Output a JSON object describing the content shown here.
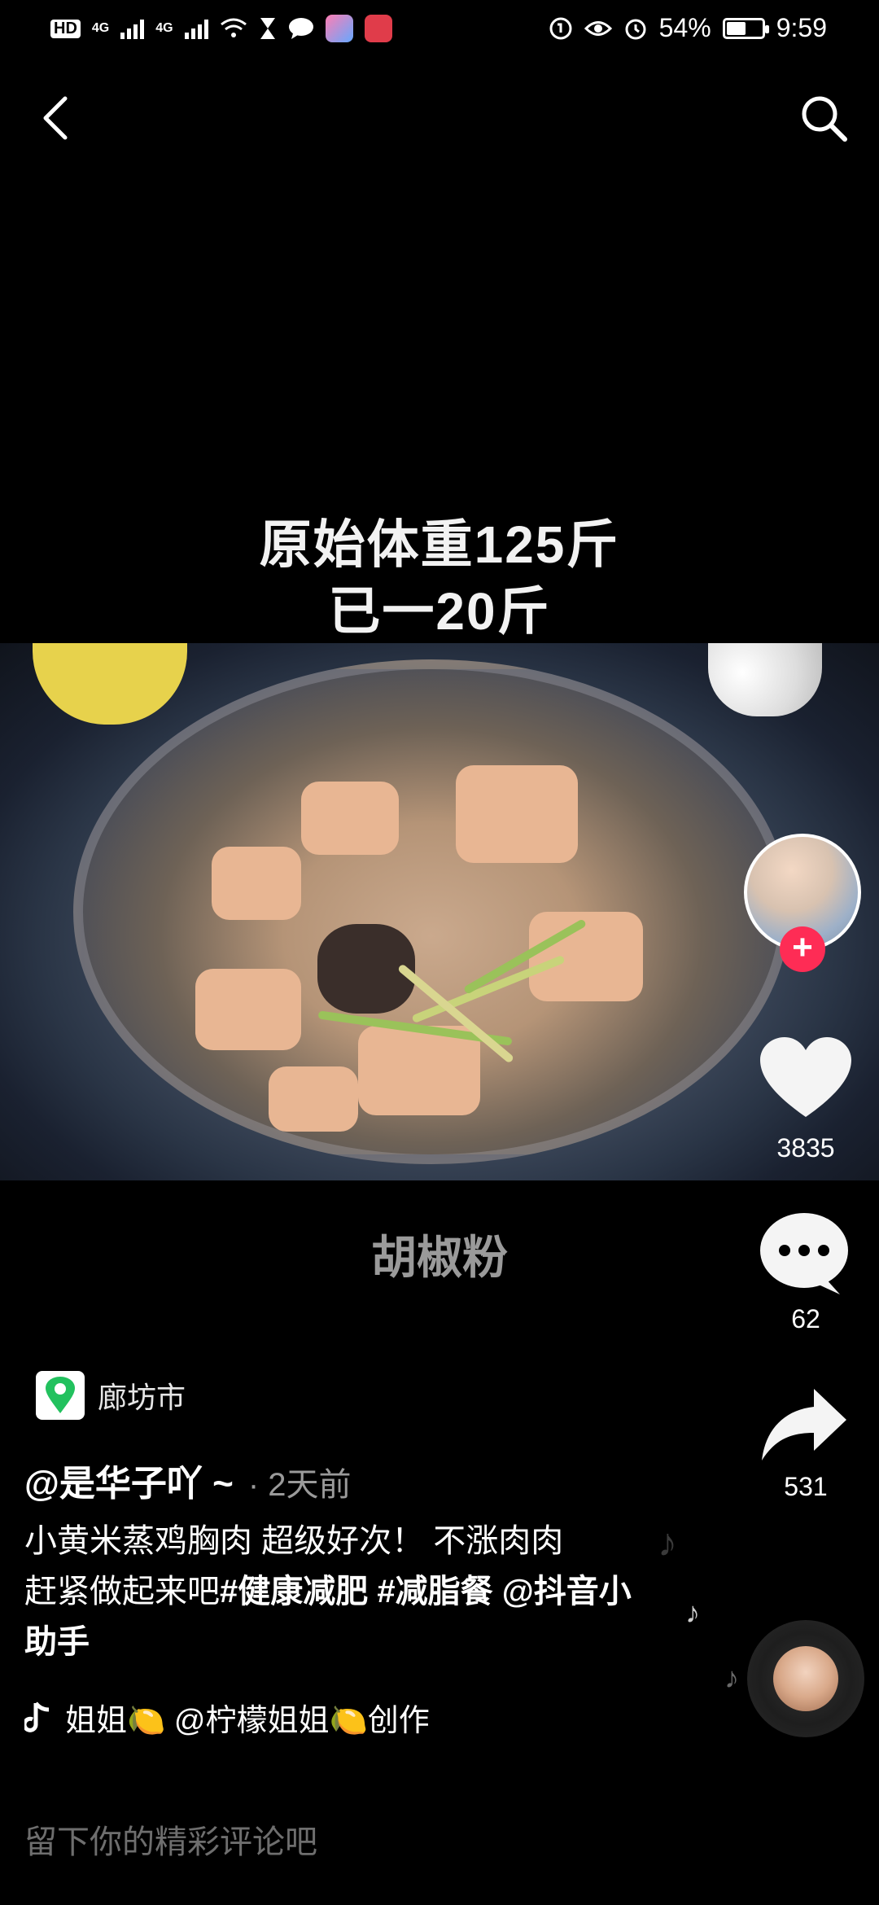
{
  "status_bar": {
    "left_text": "HD",
    "network_1": "4G",
    "network_2": "4G",
    "battery_percent": "54%",
    "battery_level": 0.54,
    "time": "9:59"
  },
  "video": {
    "overlay_line1": "原始体重125斤",
    "overlay_line2": "已一20斤",
    "subtitle": "胡椒粉"
  },
  "actions": {
    "likes": "3835",
    "comments": "62",
    "shares": "531",
    "follow_symbol": "+"
  },
  "location": {
    "label": "廊坊市"
  },
  "post": {
    "author": "@是华子吖 ~",
    "time_ago": "· 2天前",
    "desc_line1": "小黄米蒸鸡胸肉 超级好次！ 不涨肉肉",
    "desc_line2_plain": "赶紧做起来吧",
    "tag1": "#健康减肥",
    "tag2": "#减脂餐",
    "mention": "@抖音小助手"
  },
  "music": {
    "text": "姐姐🍋    @柠檬姐姐🍋创作"
  },
  "comment": {
    "placeholder": "留下你的精彩评论吧"
  },
  "colors": {
    "accent_red": "#fe2c55",
    "location_green": "#22c15e"
  }
}
